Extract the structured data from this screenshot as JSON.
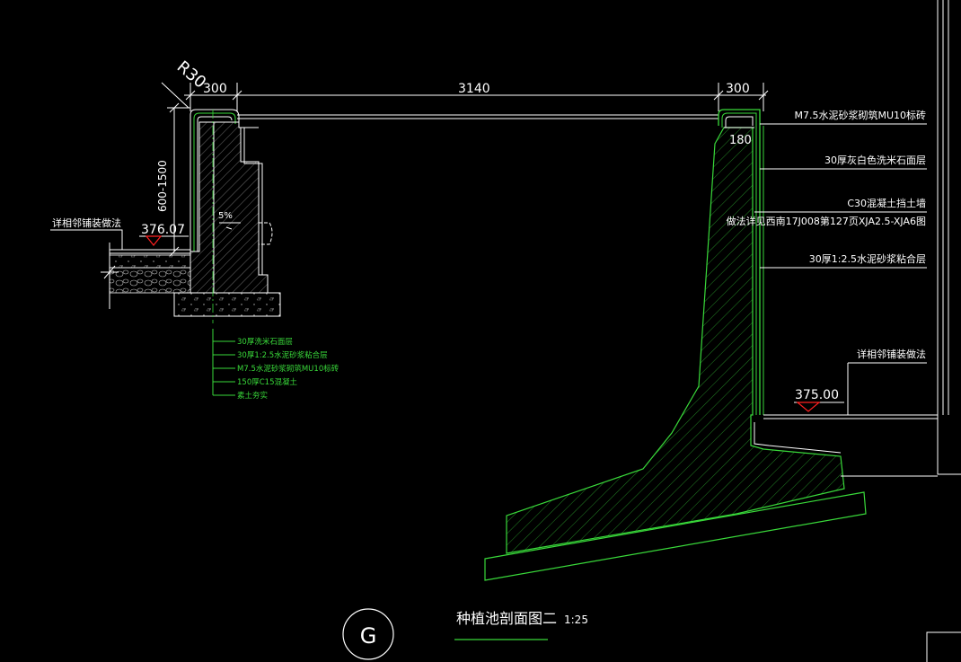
{
  "drawing": {
    "title": "种植池剖面图二",
    "scale": "1:25",
    "detail_mark": "G",
    "dimensions": {
      "wall_left": "300",
      "span": "3140",
      "wall_right": "300",
      "radius": "R30",
      "height_range": "600-1500",
      "coping": "180",
      "slope": "5%"
    },
    "elevations": {
      "left": "376.07",
      "right": "375.00"
    },
    "right_labels": [
      "M7.5水泥砂浆砌筑MU10标砖",
      "30厚灰白色洗米石面层",
      "C30混凝土挡土墙",
      "做法详见西南17J008第127页XJA2.5-XJA6图",
      "30厚1:2.5水泥砂浆粘合层",
      "详相邻铺装做法"
    ],
    "left_label": "详相邻铺装做法",
    "left_layers": [
      "30厚洗米石面层",
      "30厚1:2.5水泥砂浆粘合层",
      "M7.5水泥砂浆砌筑MU10标砖",
      "150厚C15混凝土",
      "素土夯实"
    ]
  },
  "colors": {
    "line_green": "#39d93a",
    "line_white": "#ffffff",
    "marker_red": "#ff2020",
    "background": "#000000"
  }
}
